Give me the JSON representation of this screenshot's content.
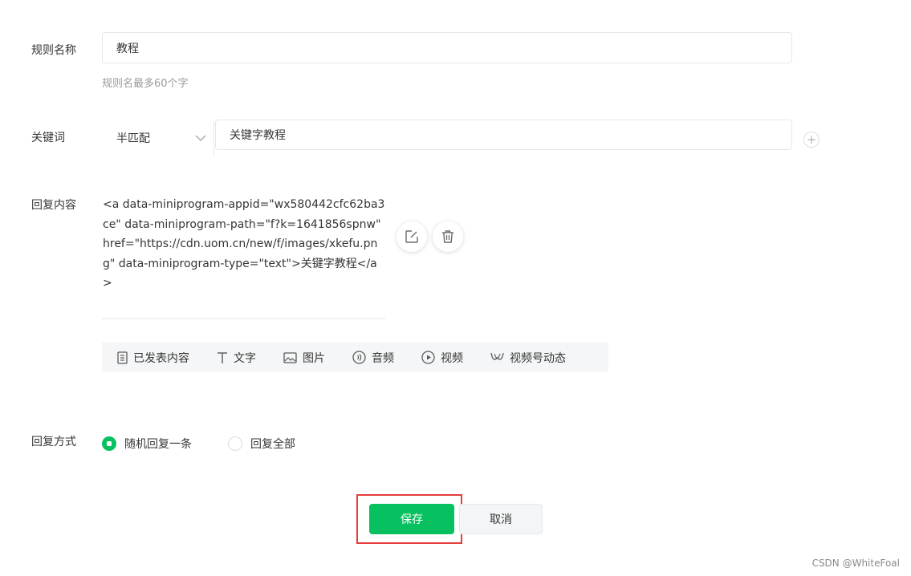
{
  "form": {
    "rule_name": {
      "label": "规则名称",
      "value": "教程",
      "hint": "规则名最多60个字"
    },
    "keyword": {
      "label": "关键词",
      "match_mode": "半匹配",
      "value": "关键字教程",
      "add_symbol": "+"
    },
    "reply": {
      "label": "回复内容",
      "content": "<a data-miniprogram-appid=\"wx580442cfc62ba3ce\" data-miniprogram-path=\"f?k=1641856spnw\" href=\"https://cdn.uom.cn/new/f/images/xkefu.png\" data-miniprogram-type=\"text\">关键字教程</a>",
      "toolbar": [
        {
          "label": "已发表内容",
          "icon": "document-icon"
        },
        {
          "label": "文字",
          "icon": "text-icon"
        },
        {
          "label": "图片",
          "icon": "image-icon"
        },
        {
          "label": "音频",
          "icon": "audio-icon"
        },
        {
          "label": "视频",
          "icon": "video-icon"
        },
        {
          "label": "视频号动态",
          "icon": "channels-icon"
        }
      ]
    },
    "reply_mode": {
      "label": "回复方式",
      "options": [
        {
          "label": "随机回复一条",
          "selected": true
        },
        {
          "label": "回复全部",
          "selected": false
        }
      ]
    }
  },
  "actions": {
    "save_label": "保存",
    "cancel_label": "取消"
  },
  "watermark": "CSDN @WhiteFoal",
  "colors": {
    "accent": "#07c160",
    "highlight_border": "#e53c3c"
  }
}
